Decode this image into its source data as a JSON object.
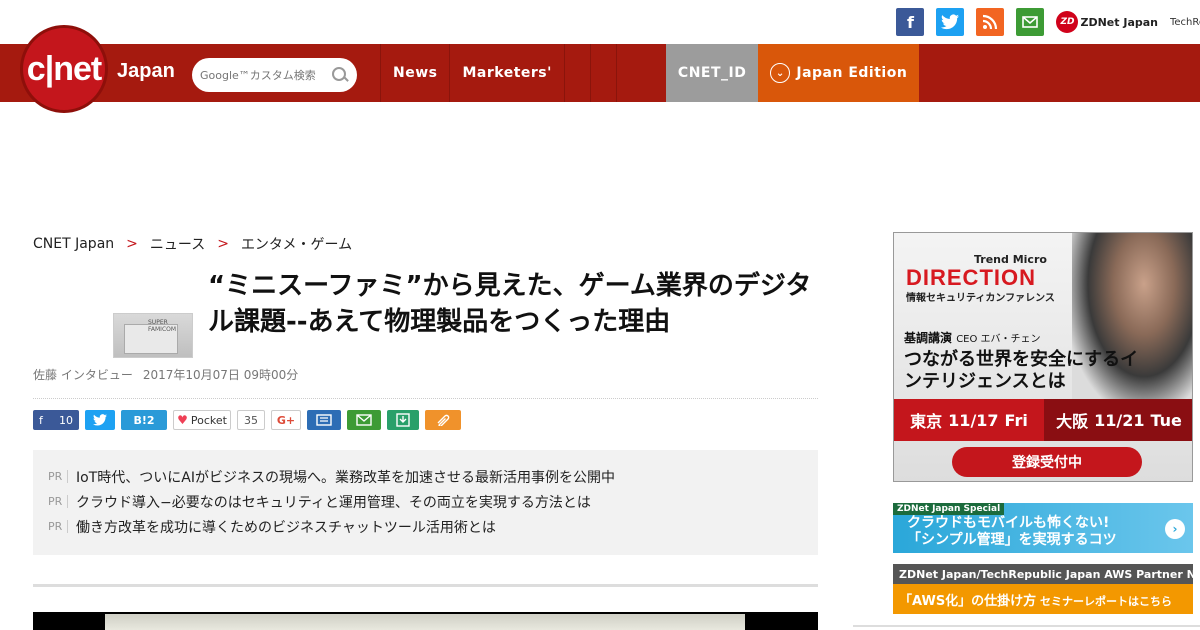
{
  "social": {
    "facebook": "f",
    "twitter": "t",
    "rss": "rss",
    "mail": "mail",
    "zdnet": "ZDNet Japan",
    "techrepublic": "TechRepublic"
  },
  "header": {
    "logo": "c|net",
    "logo_suffix": "Japan",
    "search_placeholder": "Google™カスタム検索",
    "nav": [
      "News",
      "Marketers'",
      "",
      "",
      ""
    ],
    "cnet_id": "CNET_ID",
    "edition": "Japan Edition",
    "colors": {
      "header_bg": "#a51a0f",
      "edition_bg": "#d9570a",
      "cnetid_bg": "#9c9c9c"
    }
  },
  "breadcrumb": [
    "CNET Japan",
    "ニュース",
    "エンタメ・ゲーム"
  ],
  "article": {
    "thumb_label": "SUPER FAMICOM",
    "title": "“ミニスーファミ”から見えた、ゲーム業界のデジタル課題--あえて物理製品をつくった理由",
    "author": "佐藤 インタビュー",
    "date": "2017年10月07日 09時00分"
  },
  "share": {
    "facebook_count": "10",
    "hatena_label": "B!",
    "hatena_count": "2",
    "pocket_label": "Pocket",
    "pocket_count": "35",
    "gplus": "G+"
  },
  "pr": [
    {
      "tag": "PR",
      "text": "IoT時代、ついにAIがビジネスの現場へ。業務改革を加速させる最新活用事例を公開中"
    },
    {
      "tag": "PR",
      "text": "クラウド導入−必要なのはセキュリティと運用管理、その両立を実現する方法とは"
    },
    {
      "tag": "PR",
      "text": "働き方改革を成功に導くためのビジネスチャットツール活用術とは"
    }
  ],
  "ads": {
    "trendmicro": {
      "brand": "Trend Micro",
      "event": "DIRECTION",
      "subtitle": "情報セキュリティカンファレンス",
      "speaker_label": "基調講演",
      "speaker": "CEO エバ・チェン",
      "headline": "つながる世界を安全にするインテリジェンスとは",
      "tokyo_city": "東京",
      "tokyo_date": "11/17",
      "tokyo_day": "Fri",
      "osaka_city": "大阪",
      "osaka_date": "11/21",
      "osaka_day": "Tue",
      "register": "登録受付中"
    },
    "zdnet_special": {
      "tag": "ZDNet Japan Special",
      "line1": "クラウドもモバイルも怖くない!",
      "line2": "「シンプル管理」を実現するコツ",
      "arrow": "›"
    },
    "aws": {
      "band": "ZDNet Japan/TechRepublic Japan  AWS Partner Network",
      "main": "「AWS化」の仕掛け方",
      "sub": " セミナーレポートはこちら"
    }
  }
}
